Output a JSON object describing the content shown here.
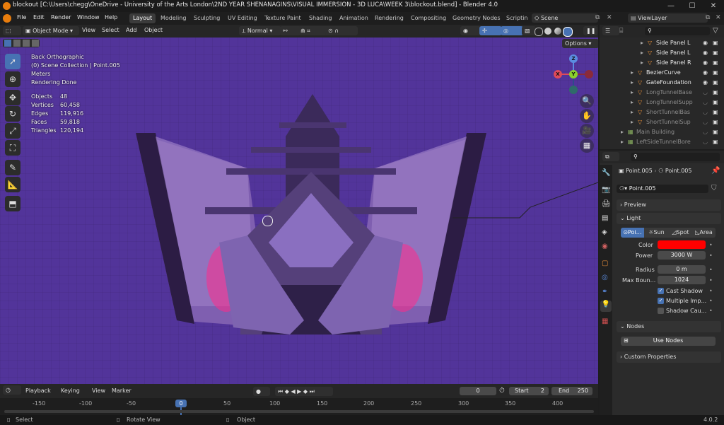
{
  "window": {
    "title": "blockout [C:\\Users\\chegg\\OneDrive - University of the Arts London\\2ND YEAR SHENANAGINS\\VISUAL IMMERSION - 3D LUCA\\WEEK 3\\blockout.blend] - Blender 4.0",
    "minimize": "—",
    "maximize": "☐",
    "close": "✕"
  },
  "menu": {
    "items": [
      "File",
      "Edit",
      "Render",
      "Window",
      "Help"
    ]
  },
  "workspaces": {
    "tabs": [
      "Layout",
      "Modeling",
      "Sculpting",
      "UV Editing",
      "Texture Paint",
      "Shading",
      "Animation",
      "Rendering",
      "Compositing",
      "Geometry Nodes",
      "Scriptin"
    ],
    "active": "Layout"
  },
  "scene": {
    "label": "Scene",
    "view_layer": "ViewLayer"
  },
  "viewport_header": {
    "mode": "Object Mode",
    "menus": [
      "View",
      "Select",
      "Add",
      "Object"
    ],
    "orientation": "Normal",
    "options": "Options"
  },
  "overlay": {
    "view": "Back Orthographic",
    "collection": "(0) Scene Collection | Point.005",
    "units": "Meters",
    "render_status": "Rendering Done",
    "stats": [
      {
        "label": "Objects",
        "value": "48"
      },
      {
        "label": "Vertices",
        "value": "60,458"
      },
      {
        "label": "Edges",
        "value": "119,916"
      },
      {
        "label": "Faces",
        "value": "59,818"
      },
      {
        "label": "Triangles",
        "value": "120,194"
      }
    ]
  },
  "gizmo": {
    "z": "Z",
    "x": "X",
    "y": "Y"
  },
  "outliner": {
    "rows": [
      {
        "name": "Side Panel L",
        "color": "#e8e8e8"
      },
      {
        "name": "Side Panel L",
        "color": "#e8e8e8"
      },
      {
        "name": "Side Panel R",
        "color": "#e8e8e8"
      },
      {
        "name": "BezierCurve",
        "color": "#e8e8e8"
      },
      {
        "name": "GateFoundation",
        "color": "#e8e8e8"
      },
      {
        "name": "LongTunnelBase",
        "color": "#8c8c8c"
      },
      {
        "name": "LongTunnelSupp",
        "color": "#8c8c8c"
      },
      {
        "name": "ShortTunnelBas",
        "color": "#8c8c8c"
      },
      {
        "name": "ShortTunnelSup",
        "color": "#8c8c8c"
      },
      {
        "name": "Main Building",
        "color": "#8c8c8c"
      },
      {
        "name": "LeftSideTunnelBore",
        "color": "#8c8c8c"
      }
    ]
  },
  "properties": {
    "breadcrumb": [
      "Point.005",
      "Point.005"
    ],
    "datablock": "Point.005",
    "preview": "Preview",
    "light": "Light",
    "light_types": [
      "Poi…",
      "Sun",
      "Spot",
      "Area"
    ],
    "color_label": "Color",
    "color_value": "#ff0000",
    "power_label": "Power",
    "power_value": "3000 W",
    "radius_label": "Radius",
    "radius_value": "0 m",
    "maxb_label": "Max Boun...",
    "maxb_value": "1024",
    "cast_shadow": "Cast Shadow",
    "multiple_imp": "Multiple Imp...",
    "shadow_caustics": "Shadow Cau...",
    "nodes": "Nodes",
    "use_nodes": "Use Nodes",
    "custom_props": "Custom Properties"
  },
  "timeline": {
    "menus": [
      "Playback",
      "Keying",
      "View",
      "Marker"
    ],
    "current_frame": "0",
    "start_label": "Start",
    "start": "2",
    "end_label": "End",
    "end": "250",
    "ticks": [
      "-150",
      "-100",
      "-50",
      "0",
      "50",
      "100",
      "150",
      "200",
      "250",
      "300",
      "350",
      "400"
    ],
    "playhead": "0"
  },
  "status": {
    "select": "Select",
    "rotate": "Rotate View",
    "object": "Object",
    "version": "4.0.2"
  }
}
